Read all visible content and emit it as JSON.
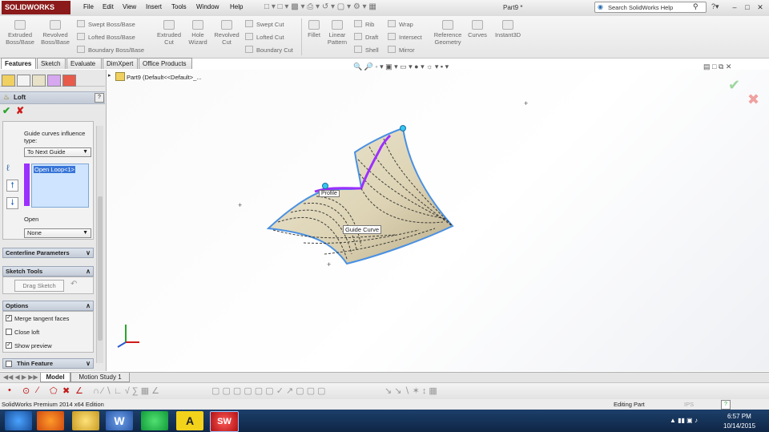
{
  "app": {
    "logo": "SOLIDWORKS",
    "doc_title": "Part9 *"
  },
  "menu": [
    "File",
    "Edit",
    "View",
    "Insert",
    "Tools",
    "Window",
    "Help"
  ],
  "search": {
    "placeholder": "Search SolidWorks Help"
  },
  "commands": {
    "extruded_boss": "Extruded Boss/Base",
    "revolved_boss": "Revolved Boss/Base",
    "swept_boss": "Swept Boss/Base",
    "lofted_boss": "Lofted Boss/Base",
    "boundary_boss": "Boundary Boss/Base",
    "extruded_cut": "Extruded Cut",
    "hole_wizard": "Hole Wizard",
    "revolved_cut": "Revolved Cut",
    "swept_cut": "Swept Cut",
    "lofted_cut": "Lofted Cut",
    "boundary_cut": "Boundary Cut",
    "fillet": "Fillet",
    "linear_pattern": "Linear Pattern",
    "rib": "Rib",
    "draft": "Draft",
    "shell": "Shell",
    "wrap": "Wrap",
    "intersect": "Intersect",
    "mirror": "Mirror",
    "reference_geometry": "Reference Geometry",
    "curves": "Curves",
    "instant3d": "Instant3D"
  },
  "tabs": [
    "Features",
    "Sketch",
    "Evaluate",
    "DimXpert",
    "Office Products"
  ],
  "property_manager": {
    "title": "Loft",
    "guide_influence_label": "Guide curves influence type:",
    "guide_influence_value": "To Next Guide",
    "list_item": "Open Loop<1>",
    "open_label": "Open",
    "open_value": "None",
    "centerline": "Centerline Parameters",
    "sketch_tools": "Sketch Tools",
    "drag_sketch": "Drag Sketch",
    "options": "Options",
    "merge_tangent": "Merge tangent faces",
    "close_loft": "Close loft",
    "show_preview": "Show preview",
    "thin_feature": "Thin Feature"
  },
  "tree": {
    "root": "Part9  (Default<<Default>_..."
  },
  "viewport": {
    "callout_profile": "Profile",
    "callout_guide": "Guide Curve"
  },
  "bottom_tabs": [
    "Model",
    "Motion Study 1"
  ],
  "status": {
    "left": "SolidWorks Premium 2014 x64 Edition",
    "mode": "Editing Part",
    "units": "IPS"
  },
  "taskbar": {
    "time": "6:57 PM",
    "date": "10/14/2015"
  },
  "colors": {
    "accent_red": "#8b1a1a",
    "selection_purple": "#9b30ff",
    "edge_blue": "#4a90e2",
    "surface": "#e6dfc5",
    "taskbar": "#1c3f6a"
  }
}
